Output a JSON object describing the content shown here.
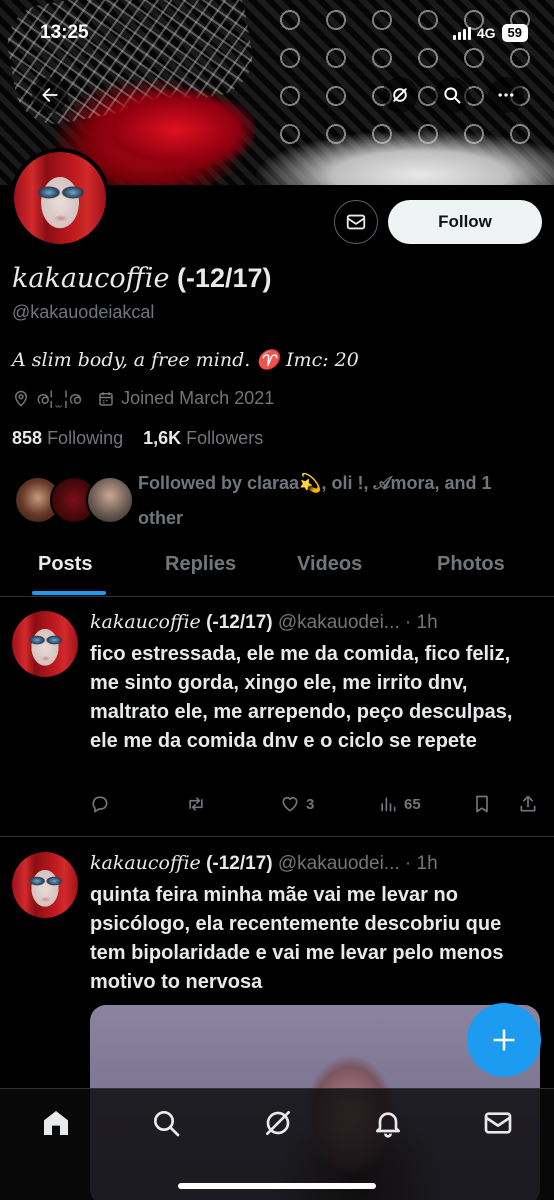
{
  "status_bar": {
    "time": "13:25",
    "network": "4G",
    "battery": "59"
  },
  "profile": {
    "display_name_styled": "kakaucoffie",
    "display_name_suffix": "(-12/17)",
    "handle": "@kakauodeiakcal",
    "bio": "A slim body, a free mind. ♈ Imc: 20",
    "location": "ര¦ ̫ ¦ര",
    "joined": "Joined March 2021",
    "following_count": "858",
    "following_label": "Following",
    "followers_count": "1,6K",
    "followers_label": "Followers",
    "followed_by": "Followed by claraa💫, oli !, 𝒜mora, and 1 other",
    "follow_button": "Follow"
  },
  "tabs": [
    "Posts",
    "Replies",
    "Videos",
    "Photos"
  ],
  "active_tab": "Posts",
  "tweets": [
    {
      "name_styled": "kakaucoffie",
      "name_suffix": "(-12/17)",
      "handle_time": "@kakauodei... · 1h",
      "text": "fico estressada, ele me da comida, fico feliz, me sinto gorda, xingo ele, me irrito dnv, maltrato ele, me arrependo, peço desculpas, ele me da comida dnv e o ciclo se repete",
      "replies": "",
      "retweets": "",
      "likes": "3",
      "views": "65"
    },
    {
      "name_styled": "kakaucoffie",
      "name_suffix": "(-12/17)",
      "handle_time": "@kakauodei... · 1h",
      "text": "quinta feira minha mãe vai me levar no psicólogo, ela recentemente descobriu que tem bipolaridade e vai me levar pelo menos motivo to nervosa"
    }
  ],
  "colors": {
    "accent": "#1d9bf0",
    "background": "#000000",
    "secondary_text": "#71767b",
    "primary_text": "#e7e9ea"
  }
}
